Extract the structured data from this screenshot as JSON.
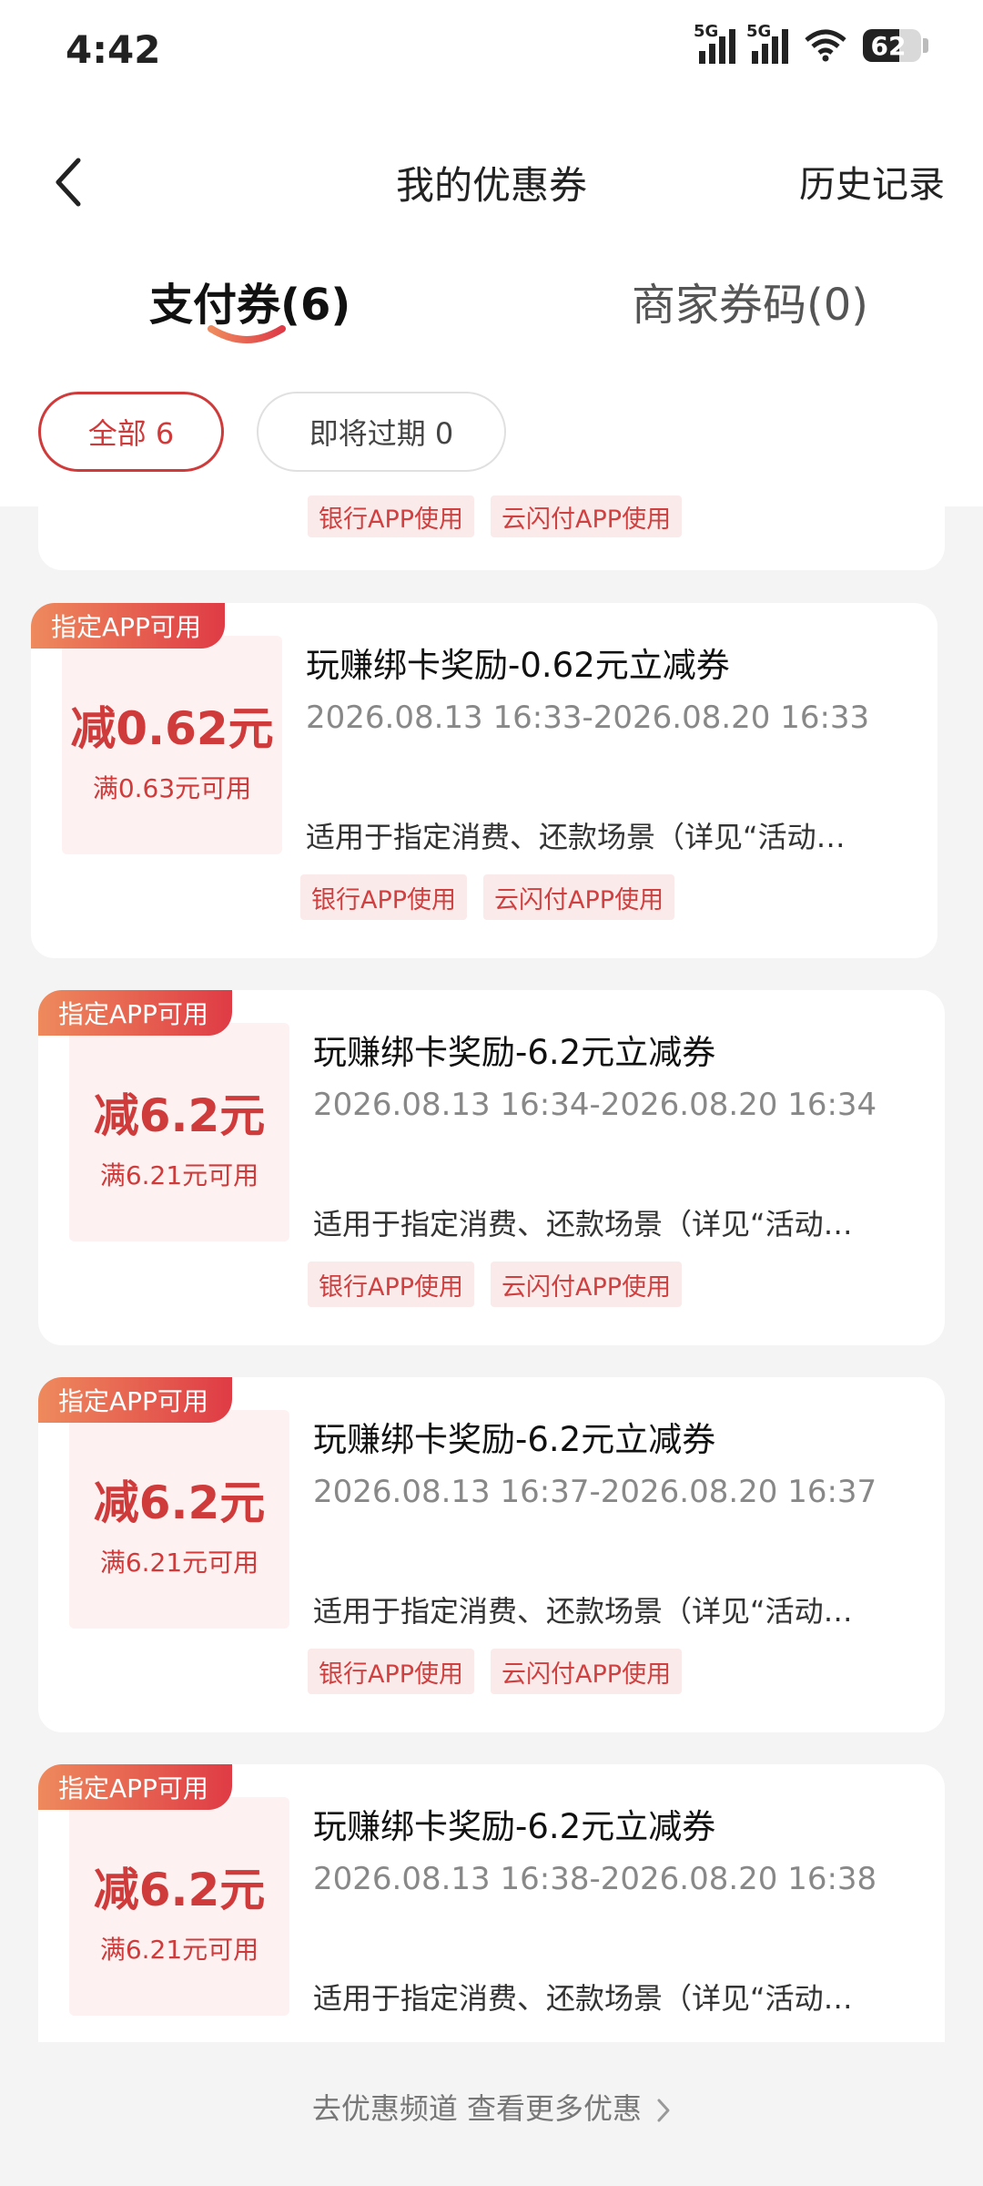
{
  "status_bar": {
    "time": "4:42",
    "signal1_label": "5G",
    "signal2_label": "5G",
    "battery": "62"
  },
  "header": {
    "title": "我的优惠券",
    "history": "历史记录"
  },
  "tabs": [
    {
      "label": "支付券(6)",
      "active": true
    },
    {
      "label": "商家券码(0)",
      "active": false
    }
  ],
  "filters": [
    {
      "label": "全部 6",
      "active": true
    },
    {
      "label": "即将过期 0",
      "active": false
    }
  ],
  "partial_card_tags": [
    "银行APP使用",
    "云闪付APP使用"
  ],
  "coupons": [
    {
      "ribbon": "指定APP可用",
      "amount": "减0.62元",
      "min_spend": "满0.63元可用",
      "title": "玩赚绑卡奖励-0.62元立减券",
      "validity": "2026.08.13 16:33-2026.08.20 16:33",
      "description": "适用于指定消费、还款场景（详见“活动…",
      "tags": [
        "银行APP使用",
        "云闪付APP使用"
      ]
    },
    {
      "ribbon": "指定APP可用",
      "amount": "减6.2元",
      "min_spend": "满6.21元可用",
      "title": "玩赚绑卡奖励-6.2元立减券",
      "validity": "2026.08.13 16:34-2026.08.20 16:34",
      "description": "适用于指定消费、还款场景（详见“活动…",
      "tags": [
        "银行APP使用",
        "云闪付APP使用"
      ]
    },
    {
      "ribbon": "指定APP可用",
      "amount": "减6.2元",
      "min_spend": "满6.21元可用",
      "title": "玩赚绑卡奖励-6.2元立减券",
      "validity": "2026.08.13 16:37-2026.08.20 16:37",
      "description": "适用于指定消费、还款场景（详见“活动…",
      "tags": [
        "银行APP使用",
        "云闪付APP使用"
      ]
    },
    {
      "ribbon": "指定APP可用",
      "amount": "减6.2元",
      "min_spend": "满6.21元可用",
      "title": "玩赚绑卡奖励-6.2元立减券",
      "validity": "2026.08.13 16:38-2026.08.20 16:38",
      "description": "适用于指定消费、还款场景（详见“活动…",
      "tags": []
    }
  ],
  "footer": {
    "more_link": "去优惠频道 查看更多优惠"
  },
  "colors": {
    "accent": "#cf3b3b",
    "ribbon_start": "#ee8a5d",
    "ribbon_end": "#df3b45",
    "tag_bg": "#fbeaea",
    "background": "#f4f4f4"
  }
}
